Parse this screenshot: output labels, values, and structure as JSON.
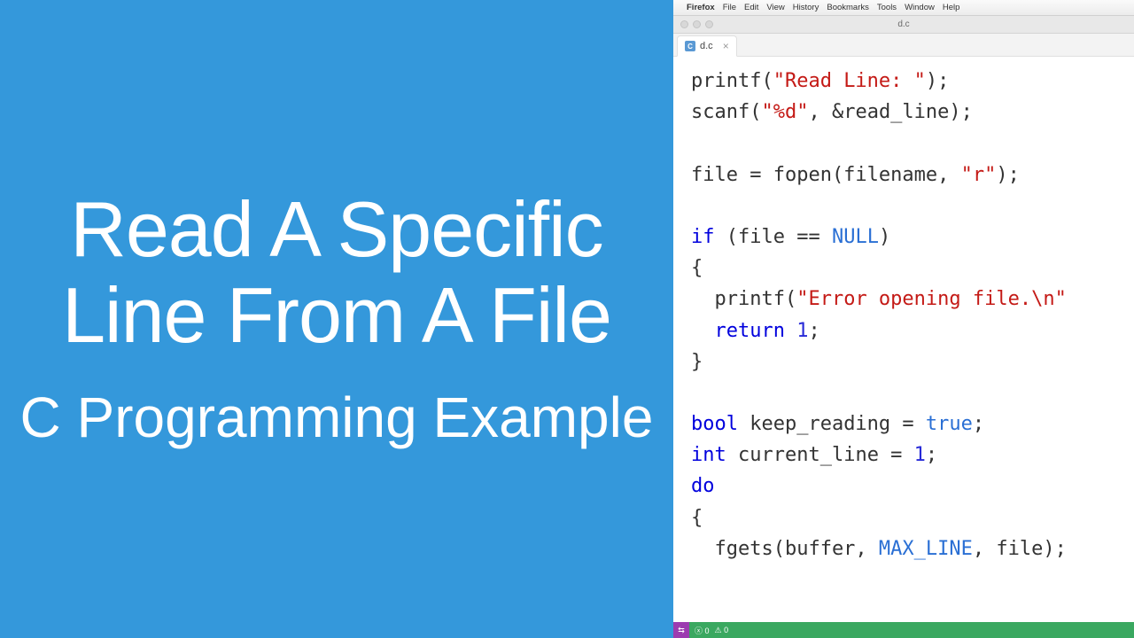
{
  "left": {
    "main_title": "Read A Specific Line From A File",
    "sub_title": "C Programming Example"
  },
  "menubar": {
    "app": "Firefox",
    "items": [
      "File",
      "Edit",
      "View",
      "History",
      "Bookmarks",
      "Tools",
      "Window",
      "Help"
    ]
  },
  "window": {
    "title": "d.c"
  },
  "tab": {
    "badge": "C",
    "filename": "d.c",
    "close": "×"
  },
  "code": {
    "l1": {
      "a": "printf(",
      "b": "\"Read Line: \"",
      "c": ");"
    },
    "l2": {
      "a": "scanf(",
      "b": "\"%d\"",
      "c": ", &read_line);"
    },
    "l3": "",
    "l4": {
      "a": "file = fopen(filename, ",
      "b": "\"r\"",
      "c": ");"
    },
    "l5": "",
    "l6": {
      "a": "if",
      "b": " (file == ",
      "c": "NULL",
      "d": ")"
    },
    "l7": "{",
    "l8": {
      "a": "  printf(",
      "b": "\"Error opening file.\\n\"",
      "c": ""
    },
    "l9": {
      "a": "  ",
      "b": "return",
      "c": " ",
      "d": "1",
      "e": ";"
    },
    "l10": "}",
    "l11": "",
    "l12": {
      "a": "bool",
      "b": " keep_reading = ",
      "c": "true",
      "d": ";"
    },
    "l13": {
      "a": "int",
      "b": " current_line = ",
      "c": "1",
      "d": ";"
    },
    "l14": {
      "a": "do"
    },
    "l15": "{",
    "l16": {
      "a": "  fgets(buffer, ",
      "b": "MAX_LINE",
      "c": ", file);"
    }
  },
  "status": {
    "remote_icon": "⇆",
    "errors": "0",
    "warnings": "0"
  }
}
